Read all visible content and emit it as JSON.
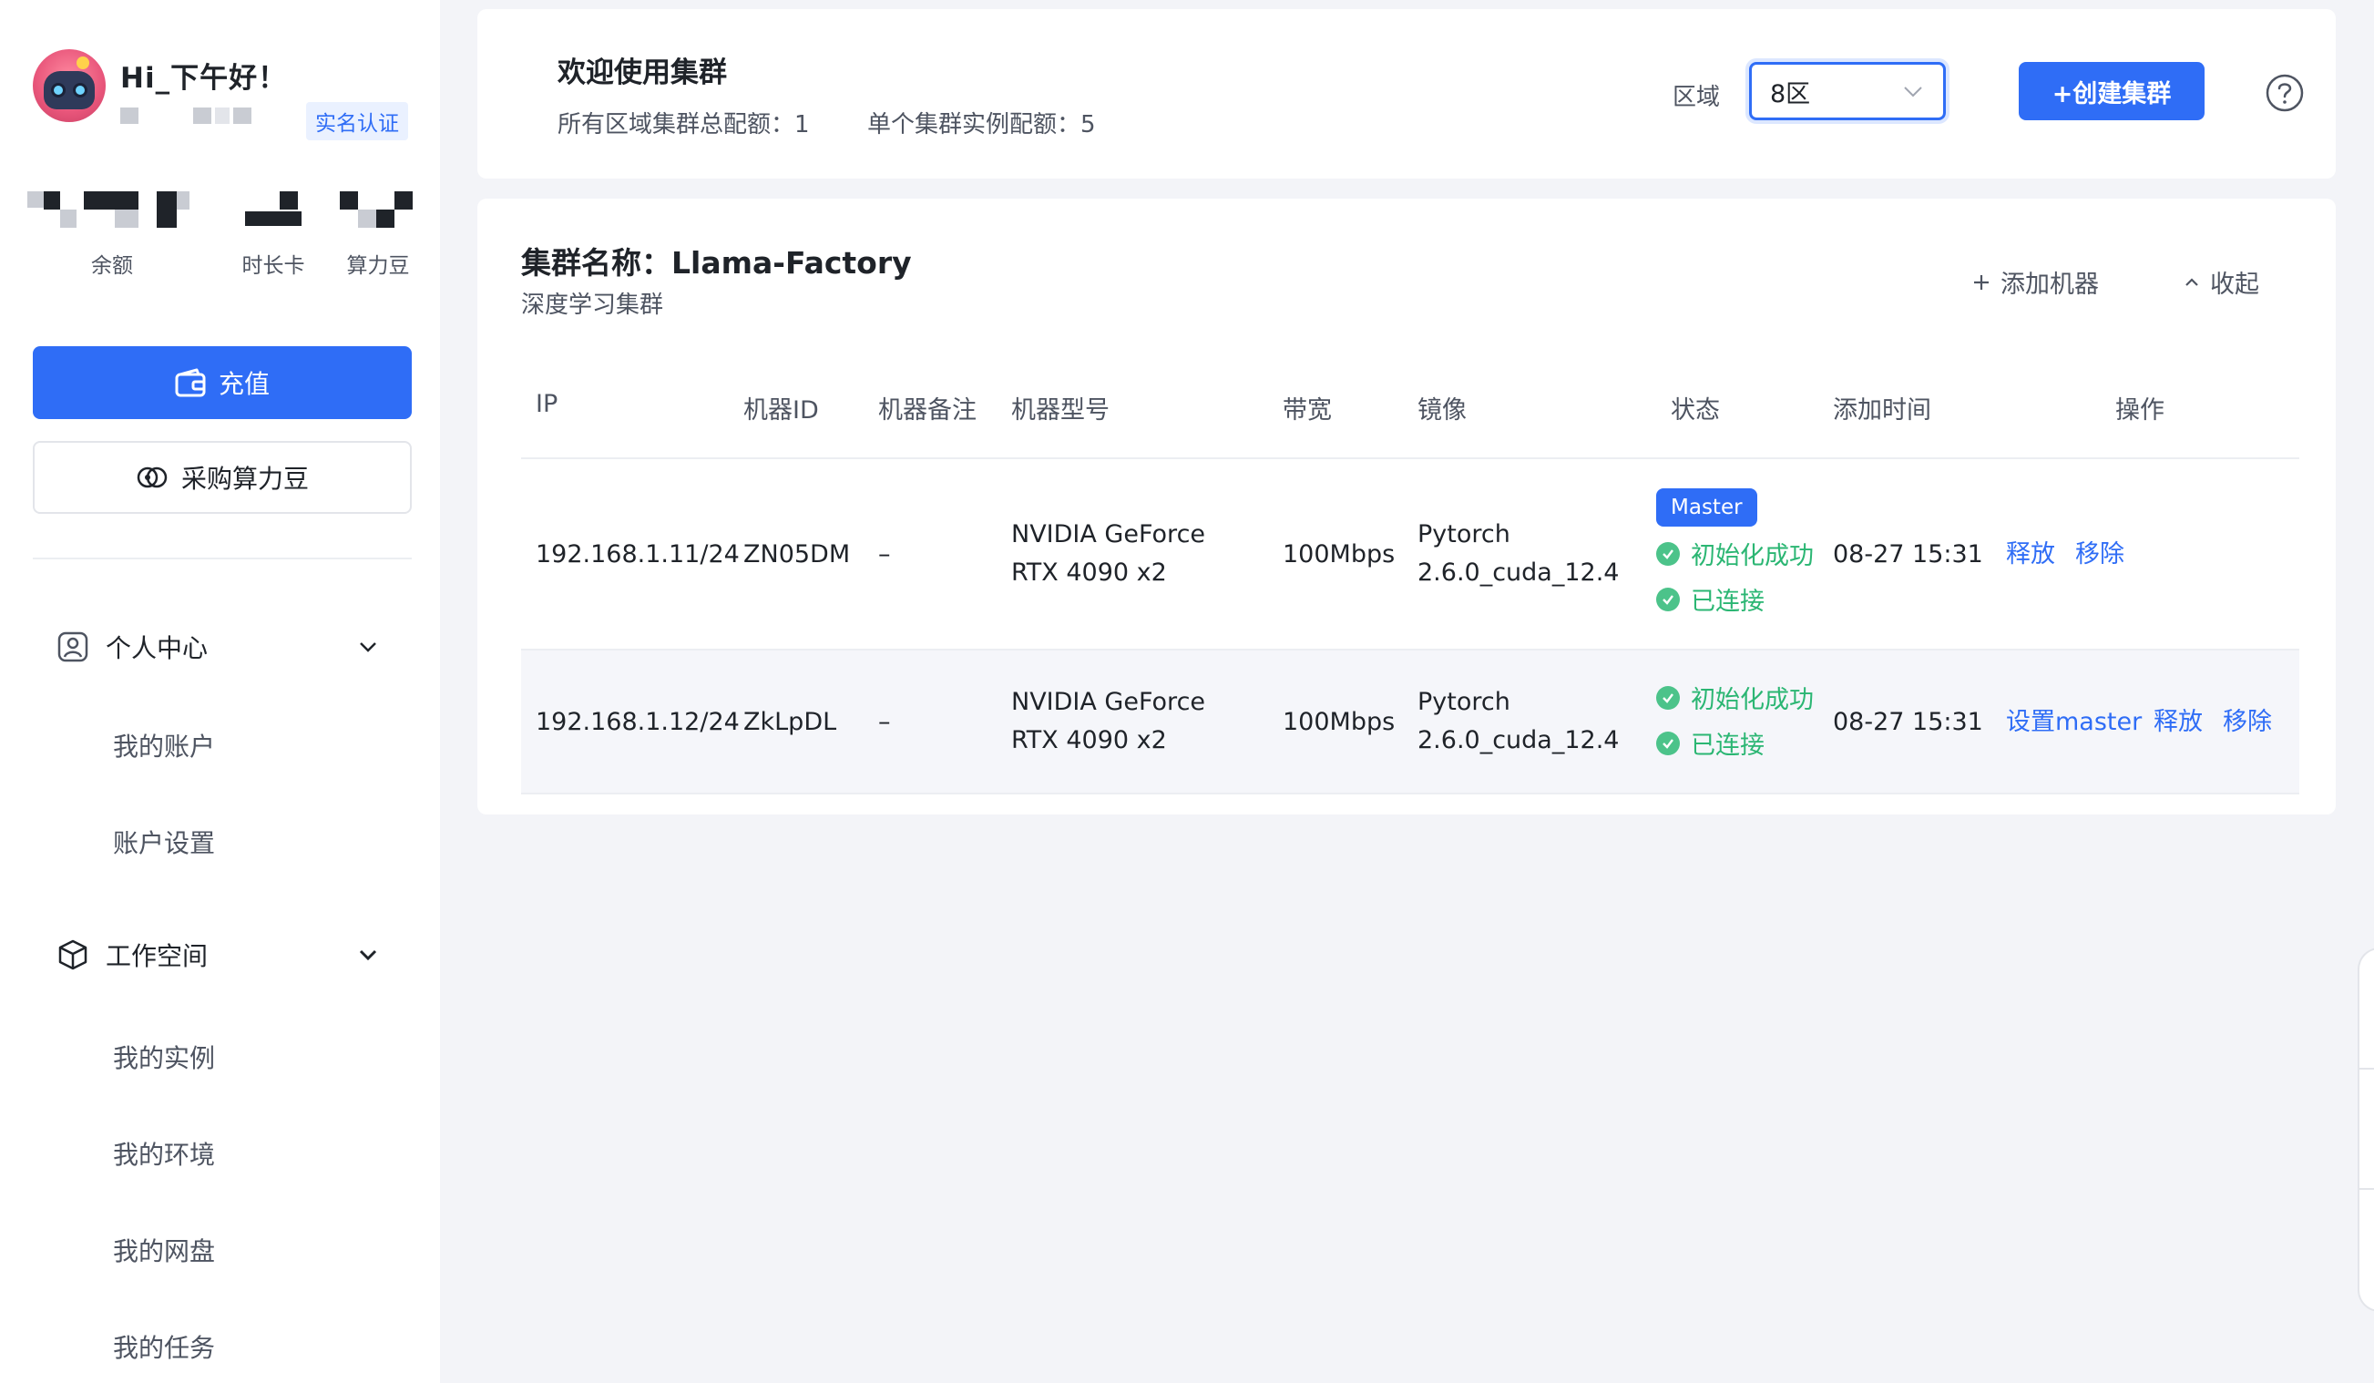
{
  "user": {
    "greeting": "Hi_下午好！",
    "verify_label": "实名认证"
  },
  "stats": {
    "balance_label": "余额",
    "time_card_label": "时长卡",
    "compute_bean_label": "算力豆"
  },
  "sidebar": {
    "recharge_label": "充值",
    "buy_beans_label": "采购算力豆",
    "groups": [
      {
        "label": "个人中心",
        "items": [
          "我的账户",
          "账户设置"
        ]
      },
      {
        "label": "工作空间",
        "items": [
          "我的实例",
          "我的环境",
          "我的网盘",
          "我的任务"
        ]
      }
    ]
  },
  "header": {
    "title": "欢迎使用集群",
    "quota_total": "所有区域集群总配额：1",
    "quota_single": "单个集群实例配额：5",
    "region_label": "区域",
    "region_value": "8区",
    "create_label": "+创建集群"
  },
  "cluster": {
    "name": "集群名称：Llama-Factory",
    "subtitle": "深度学习集群",
    "add_machine_label": "添加机器",
    "collapse_label": "收起",
    "columns": [
      "IP",
      "机器ID",
      "机器备注",
      "机器型号",
      "带宽",
      "镜像",
      "状态",
      "添加时间",
      "操作"
    ],
    "rows": [
      {
        "ip": "192.168.1.11/24",
        "machine_id": "ZN05DM",
        "note": "–",
        "model_line1": "NVIDIA GeForce",
        "model_line2": "RTX 4090 x2",
        "bandwidth": "100Mbps",
        "image_line1": "Pytorch",
        "image_line2": "2.6.0_cuda_12.4",
        "tag": "Master",
        "status_init": "初始化成功",
        "status_conn": "已连接",
        "added": "08-27 15:31",
        "ops": [
          "释放",
          "移除"
        ]
      },
      {
        "ip": "192.168.1.12/24",
        "machine_id": "ZkLpDL",
        "note": "–",
        "model_line1": "NVIDIA GeForce",
        "model_line2": "RTX 4090 x2",
        "bandwidth": "100Mbps",
        "image_line1": "Pytorch",
        "image_line2": "2.6.0_cuda_12.4",
        "status_init": "初始化成功",
        "status_conn": "已连接",
        "added": "08-27 15:31",
        "ops": [
          "设置master",
          "释放",
          "移除"
        ]
      }
    ]
  },
  "colors": {
    "primary": "#2f6df6",
    "success": "#2bb673",
    "text": "#1f2329",
    "muted": "#4e5461",
    "background": "#f3f4f8"
  }
}
